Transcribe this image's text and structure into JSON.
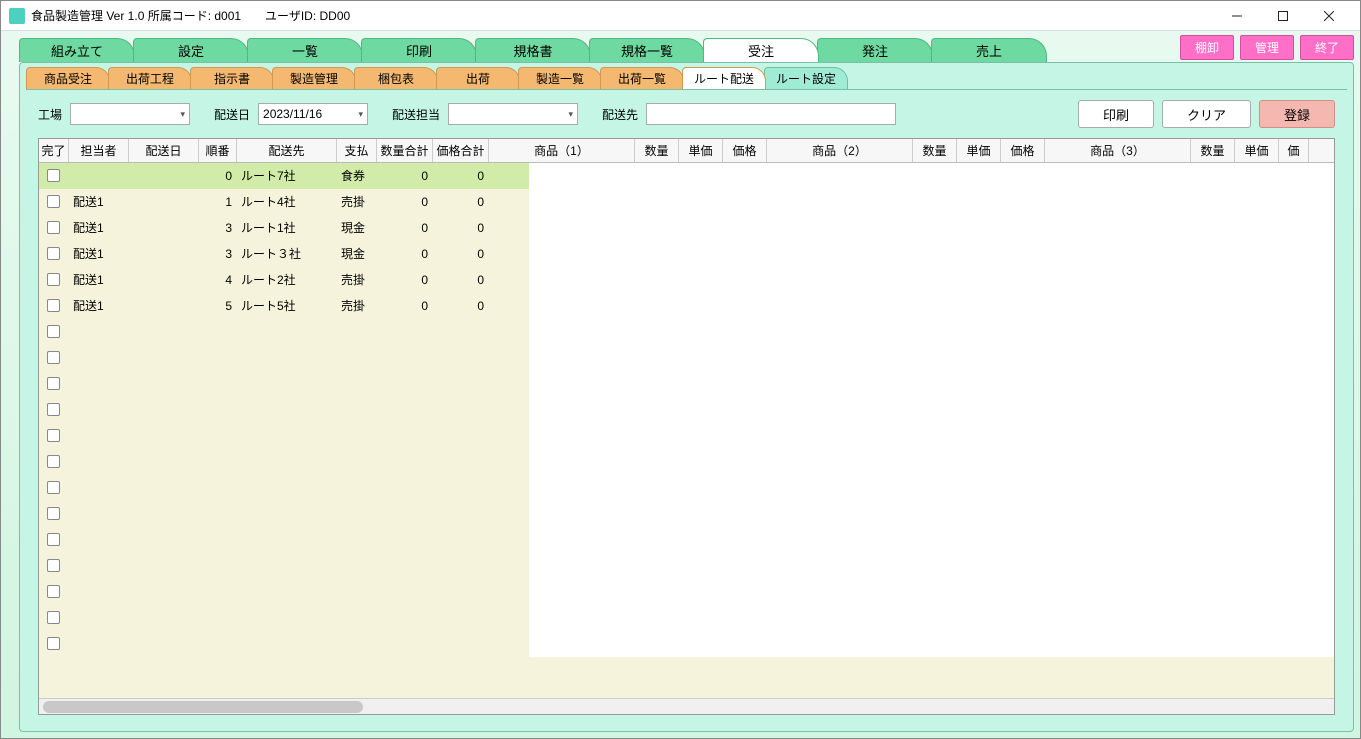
{
  "window": {
    "title": "食品製造管理 Ver 1.0  所属コード: d001　　ユーザID: DD00"
  },
  "mainTabs": [
    "組み立て",
    "設定",
    "一覧",
    "印刷",
    "規格書",
    "規格一覧",
    "受注",
    "発注",
    "売上"
  ],
  "mainTabActive": 6,
  "cornerButtons": [
    "棚卸",
    "管理",
    "終了"
  ],
  "subTabs": [
    {
      "label": "商品受注",
      "style": "orange"
    },
    {
      "label": "出荷工程",
      "style": "orange"
    },
    {
      "label": "指示書",
      "style": "orange"
    },
    {
      "label": "製造管理",
      "style": "orange"
    },
    {
      "label": "梱包表",
      "style": "orange"
    },
    {
      "label": "出荷",
      "style": "orange"
    },
    {
      "label": "製造一覧",
      "style": "orange"
    },
    {
      "label": "出荷一覧",
      "style": "orange"
    },
    {
      "label": "ルート配送",
      "style": "active"
    },
    {
      "label": "ルート設定",
      "style": "teal"
    }
  ],
  "filters": {
    "factoryLabel": "工場",
    "factoryValue": "",
    "dateLabel": "配送日",
    "dateValue": "2023/11/16",
    "driverLabel": "配送担当",
    "driverValue": "",
    "destLabel": "配送先",
    "destValue": ""
  },
  "actions": {
    "print": "印刷",
    "clear": "クリア",
    "register": "登録"
  },
  "columns": [
    "完了",
    "担当者",
    "配送日",
    "順番",
    "配送先",
    "支払",
    "数量合計",
    "価格合計",
    "商品（1）",
    "数量",
    "単価",
    "価格",
    "商品（2）",
    "数量",
    "単価",
    "価格",
    "商品（3）",
    "数量",
    "単価",
    "価"
  ],
  "rows": [
    {
      "done": false,
      "tantou": "",
      "date": "",
      "jun": "0",
      "dest": "ルート7社",
      "pay": "食券",
      "qtot": "0",
      "ptot": "0",
      "sel": true
    },
    {
      "done": false,
      "tantou": "配送1",
      "date": "",
      "jun": "1",
      "dest": "ルート4社",
      "pay": "売掛",
      "qtot": "0",
      "ptot": "0"
    },
    {
      "done": false,
      "tantou": "配送1",
      "date": "",
      "jun": "3",
      "dest": "ルート1社",
      "pay": "現金",
      "qtot": "0",
      "ptot": "0"
    },
    {
      "done": false,
      "tantou": "配送1",
      "date": "",
      "jun": "3",
      "dest": "ルート３社",
      "pay": "現金",
      "qtot": "0",
      "ptot": "0"
    },
    {
      "done": false,
      "tantou": "配送1",
      "date": "",
      "jun": "4",
      "dest": "ルート2社",
      "pay": "売掛",
      "qtot": "0",
      "ptot": "0"
    },
    {
      "done": false,
      "tantou": "配送1",
      "date": "",
      "jun": "5",
      "dest": "ルート5社",
      "pay": "売掛",
      "qtot": "0",
      "ptot": "0"
    }
  ],
  "emptyRows": 13
}
